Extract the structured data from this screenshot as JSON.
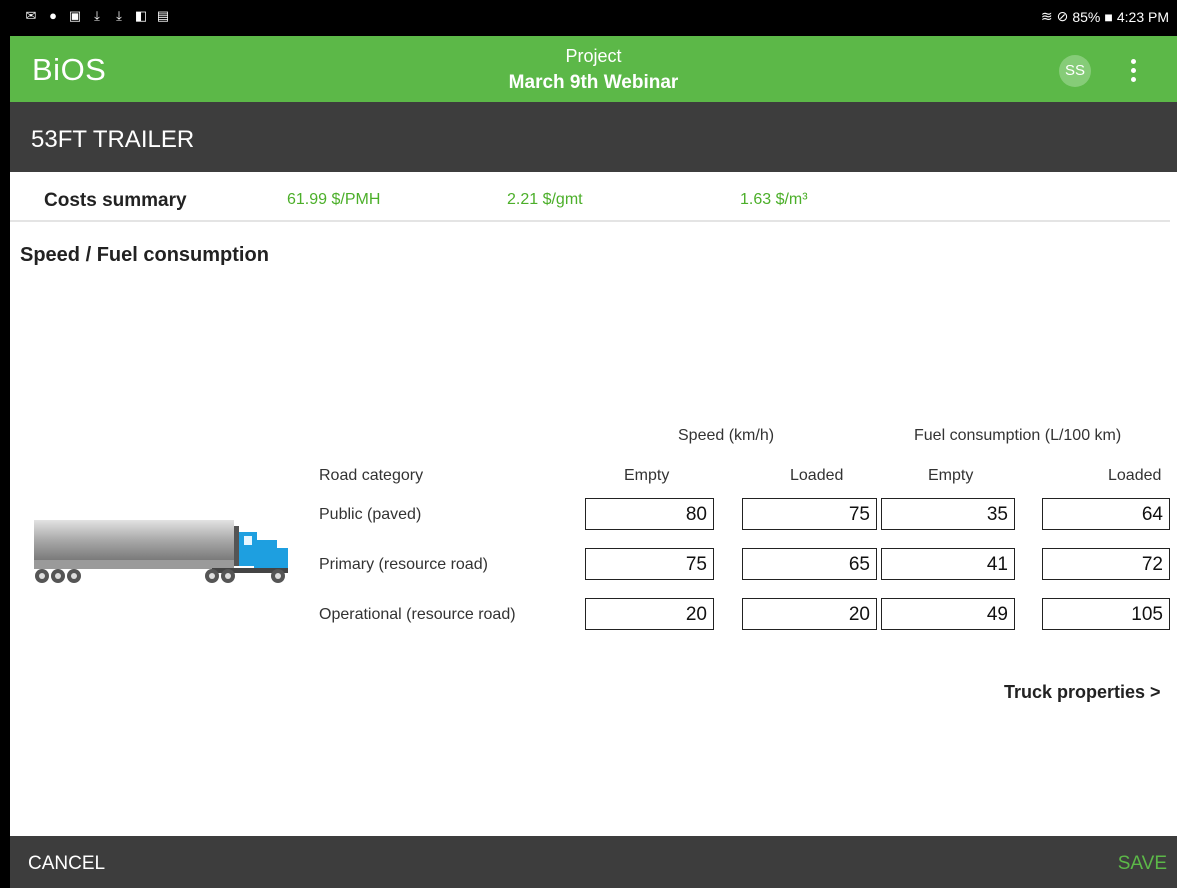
{
  "statusbar": {
    "left_icons": [
      "mail-icon",
      "bag-icon",
      "image-icon",
      "download-icon",
      "download-icon",
      "no-sim-icon",
      "no-notes-icon"
    ],
    "battery": "85%",
    "time": "4:23 PM"
  },
  "appbar": {
    "logo": "BiOS",
    "project_label": "Project",
    "project_name": "March 9th Webinar",
    "avatar": "SS"
  },
  "subheader": {
    "title": "53FT TRAILER"
  },
  "summary": {
    "label": "Costs summary",
    "pmh": "61.99 $/PMH",
    "gmt": "2.21 $/gmt",
    "m3": "1.63 $/m³"
  },
  "section_title": "Speed / Fuel consumption",
  "table": {
    "speed_header": "Speed (km/h)",
    "fuel_header": "Fuel consumption (L/100 km)",
    "road_category": "Road category",
    "col_empty": "Empty",
    "col_loaded": "Loaded",
    "rows": [
      {
        "label": "Public (paved)",
        "speed_empty": "80",
        "speed_loaded": "75",
        "fuel_empty": "35",
        "fuel_loaded": "64"
      },
      {
        "label": "Primary (resource road)",
        "speed_empty": "75",
        "speed_loaded": "65",
        "fuel_empty": "41",
        "fuel_loaded": "72"
      },
      {
        "label": "Operational (resource road)",
        "speed_empty": "20",
        "speed_loaded": "20",
        "fuel_empty": "49",
        "fuel_loaded": "105"
      }
    ]
  },
  "link": "Truck properties >",
  "bottombar": {
    "cancel": "CANCEL",
    "save": "SAVE"
  },
  "colors": {
    "primary_green": "#5cb848",
    "dark_bar": "#3d3d3d",
    "value_green": "#4caf2a",
    "truck_blue": "#1e9fe0"
  }
}
